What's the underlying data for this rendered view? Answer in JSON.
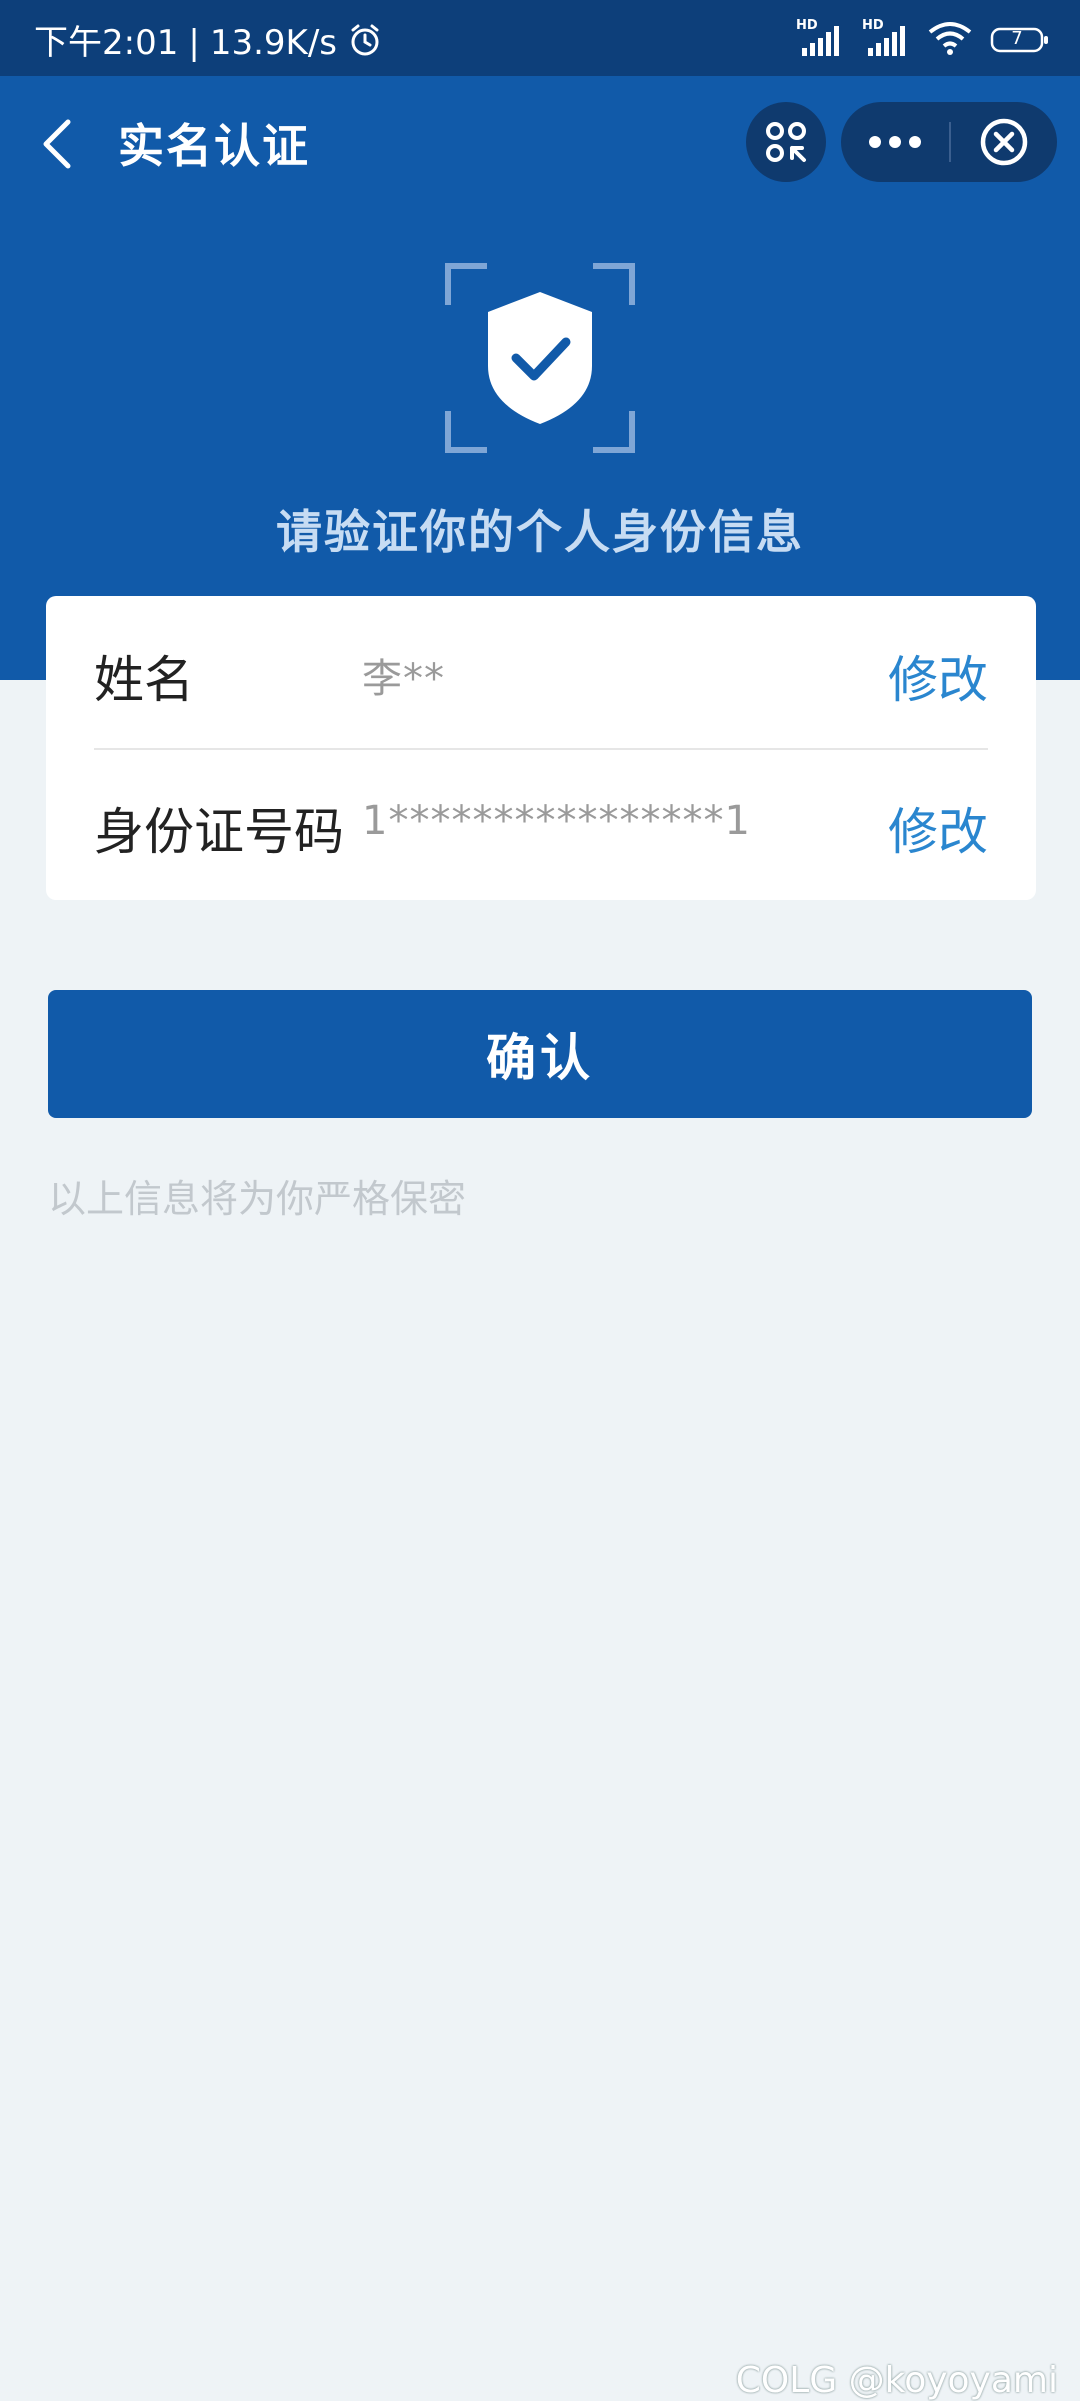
{
  "status_bar": {
    "time": "下午2:01",
    "network_speed": "13.9K/s",
    "separator": "|",
    "signal1_label": "HD",
    "signal2_label": "HD",
    "battery": "7",
    "icons": [
      "alarm-icon",
      "signal-icon",
      "signal-icon",
      "wifi-icon",
      "battery-icon"
    ]
  },
  "navbar": {
    "title": "实名认证",
    "icons": [
      "back-icon",
      "scan-icon",
      "more-icon",
      "close-icon"
    ]
  },
  "hero": {
    "heading": "请验证你的个人身份信息",
    "icon": "shield-check-icon",
    "background_color": "#115aa9"
  },
  "form": {
    "rows": [
      {
        "label": "姓名",
        "value": "李**",
        "action": "修改"
      },
      {
        "label": "身份证号码",
        "value": "1****************1",
        "action": "修改"
      }
    ]
  },
  "confirm_button": {
    "label": "确认",
    "color": "#115aa9"
  },
  "privacy_note": "以上信息将为你严格保密",
  "watermark": "COLG @koyoyami",
  "colors": {
    "accent": "#115aa9",
    "link": "#2a86cf",
    "page_background": "#eef3f6"
  }
}
